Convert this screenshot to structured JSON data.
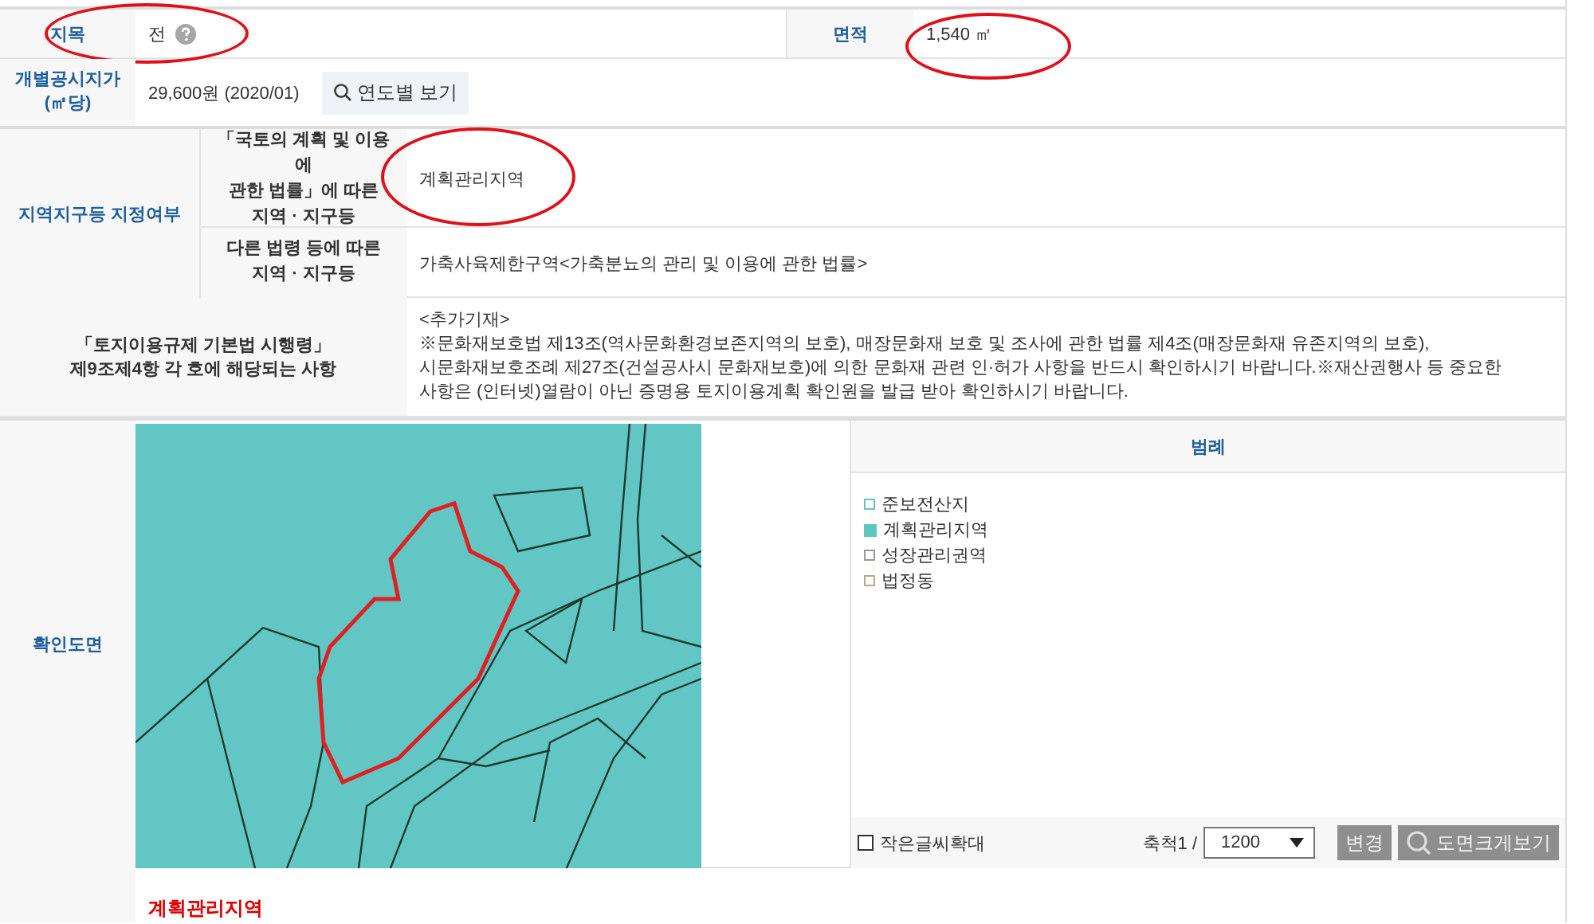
{
  "basic": {
    "category": {
      "label": "지목",
      "value": "전",
      "circled": true
    },
    "area": {
      "label": "면적",
      "value": "1,540 ㎡",
      "circled": true
    },
    "price": {
      "label": "개별공시지가 (㎡당)",
      "value": "29,600원 (2020/01)",
      "button": "연도별 보기"
    }
  },
  "zoning": {
    "label": "지역지구등 지정여부",
    "rows": [
      {
        "label": [
          "「국토의 계획 및 이용에",
          "관한 법률」에 따른",
          "지역 · 지구등"
        ],
        "value": "계획관리지역",
        "circled": true
      },
      {
        "label": [
          "다른 법령 등에 따른",
          "지역 · 지구등"
        ],
        "value": "가축사육제한구역<가축분뇨의 관리 및 이용에 관한 법률>",
        "circled": false
      }
    ]
  },
  "regulation": {
    "label": [
      "「토지이용규제 기본법 시행령」",
      "제9조제4항 각 호에 해당되는 사항"
    ],
    "lines": [
      "<추가기재>",
      "※문화재보호법 제13조(역사문화환경보존지역의 보호), 매장문화재 보호 및 조사에 관한 법률 제4조(매장문화재 유존지역의 보호),",
      "시문화재보호조례 제27조(건설공사시 문화재보호)에 의한 문화재 관련 인·허가 사항을 반드시 확인하시기 바랍니다.※재산권행사 등 중요한",
      "사항은 (인터넷)열람이 아닌 증명용 토지이용계획 확인원을 발급 받아 확인하시기 바랍니다."
    ]
  },
  "map": {
    "label": "확인도면",
    "kind": "picture",
    "legend": {
      "title": "범례",
      "items": [
        {
          "label": "준보전산지",
          "color": "#5cc8c0",
          "kind": "outline"
        },
        {
          "label": "계획관리지역",
          "color": "#5cc8c0",
          "kind": "fill"
        },
        {
          "label": "성장관리권역",
          "color": "#9a9a9a",
          "kind": "outline"
        },
        {
          "label": "법정동",
          "color": "#b8a888",
          "kind": "outline"
        }
      ]
    },
    "enlarge_text": {
      "label": "작은글씨확대",
      "checked": false
    },
    "scale": {
      "label": "축척1 /",
      "value": "1200"
    },
    "buttons": [
      {
        "label": "변경",
        "kind": "plain"
      },
      {
        "label": "도면크게보기",
        "kind": "zoom"
      }
    ]
  },
  "note": {
    "value": "계획관리지역"
  }
}
